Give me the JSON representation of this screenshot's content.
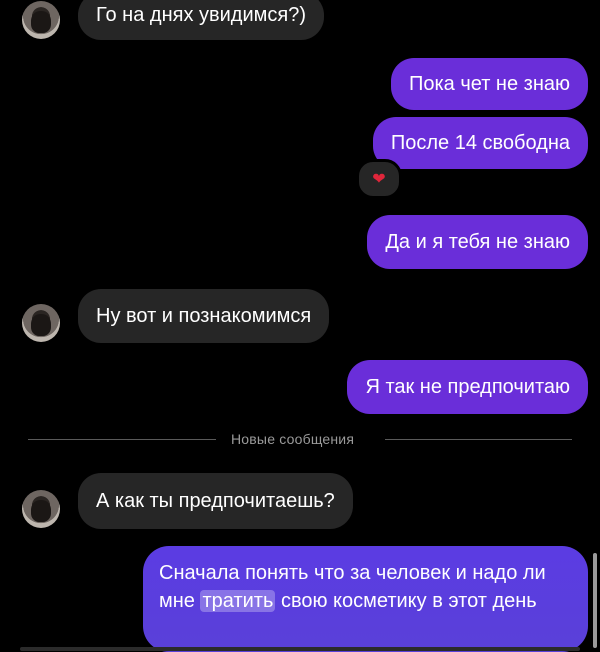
{
  "messages": [
    {
      "id": "m1",
      "sender": "them",
      "text": "Го на днях увидимся?)"
    },
    {
      "id": "m2",
      "sender": "me",
      "text": "Пока чет не знаю"
    },
    {
      "id": "m3",
      "sender": "me",
      "text": "После 14 свободна",
      "reaction": "❤"
    },
    {
      "id": "m4",
      "sender": "me",
      "text": "Да и я тебя не знаю"
    },
    {
      "id": "m5",
      "sender": "them",
      "text": "Ну вот и познакомимся"
    },
    {
      "id": "m6",
      "sender": "me",
      "text": "Я так не предпочитаю"
    },
    {
      "id": "m7",
      "sender": "them",
      "text": "А как ты предпочитаешь?"
    },
    {
      "id": "m8",
      "sender": "me",
      "text_parts": [
        "Сначала понять что за человек и надо ли мне",
        "тратить",
        "свою косметику в этот день"
      ]
    }
  ],
  "divider": {
    "label": "Новые сообщения"
  },
  "colors": {
    "background": "#000000",
    "incoming_bubble": "#262626",
    "outgoing_bubble": "#6a2ed9",
    "outgoing_gradient": "#5a40d8",
    "reaction_heart": "#e0263b"
  },
  "icons": {
    "reaction": "heart-icon",
    "avatar": "contact-avatar"
  }
}
